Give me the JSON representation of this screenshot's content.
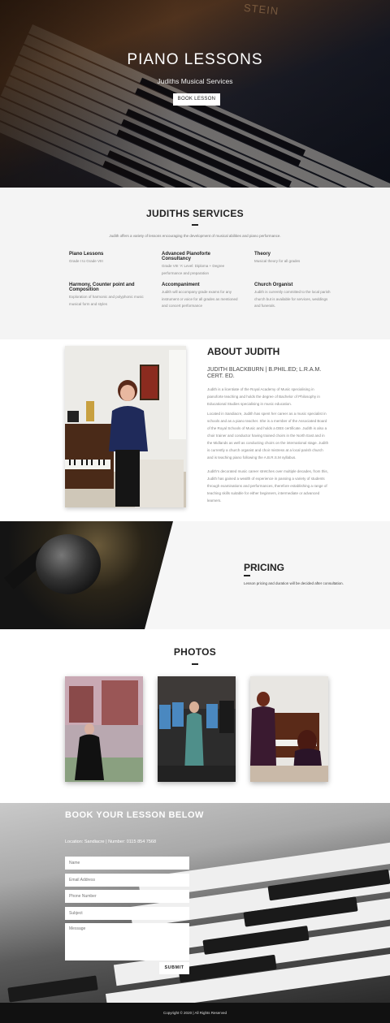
{
  "hero": {
    "title": "PIANO LESSONS",
    "subtitle": "Judiths Musical Services",
    "button": "BOOK LESSON",
    "brand": "STEIN"
  },
  "services": {
    "title": "JUDITHS SERVICES",
    "intro": "Judith offers a variety of lessons encouraging the development of musical abilities and piano performance.",
    "items": [
      {
        "title": "Piano Lessons",
        "desc": "Grade I to Grade VIII"
      },
      {
        "title": "Advanced Pianoforte Consultancy",
        "desc": "Grade VIII ‘A’ Level: Diploma + Degree performance and preparation"
      },
      {
        "title": "Theory",
        "desc": "Musical theory for all grades"
      },
      {
        "title": "Harmony, Counter point and Composition",
        "desc": "Exploration of harmonic and polyphonic music musical form and styles"
      },
      {
        "title": "Accompaniment",
        "desc": "Judith will accompany grade exams for any instrument or voice for all grades as mentioned and concert performance"
      },
      {
        "title": "Church Organist",
        "desc": "Judith is currently committed to the local parish church but is available for services, weddings and funerals."
      }
    ]
  },
  "about": {
    "title": "ABOUT JUDITH",
    "name": "JUDITH BLACKBURN | B.PHIL.ED; L.R.A.M. CERT. ED.",
    "paragraphs": [
      "Judith is a licentiate of the Royal Academy of Music specialising in pianoforte teaching and holds the degree of Bachelor of Philosophy in Educational Studies specialising in music education.",
      "Located in Sandiacre, Judith has spent her career as a music specialist in schools and as a piano teacher. She is a member of the Associated Board of the Royal Schools of Music and holds a DBS certificate. Judith is also a choir trainer and conductor having trained choirs in the North East and in the Midlands as well as conducting choirs on the international stage. Judith is currently a church organist and choir mistress at a local parish church and is teaching piano following the A.B.R.S.M syllabus.",
      "Judith's decorated music career stretches over multiple decades, from this, Judith has gained a wealth of experience in passing a variety of students through examinations and performances, therefore establishing a range of teaching skills suitable for either beginners, intermediate or advanced learners."
    ]
  },
  "pricing": {
    "title": "PRICING",
    "text": "Lesson pricing and duration will be decided after consultation."
  },
  "photos": {
    "title": "PHOTOS"
  },
  "booking": {
    "title": "BOOK YOUR LESSON BELOW",
    "subtitle": "Location: Sandiacre | Number: 0115 854 7568",
    "placeholders": {
      "name": "Name",
      "email": "Email Address",
      "phone": "Phone Number",
      "subject": "Subject",
      "message": "Message"
    },
    "submit": "SUBMIT"
  },
  "footer": {
    "text": "Copyright © 2020 | All Rights Reserved"
  }
}
